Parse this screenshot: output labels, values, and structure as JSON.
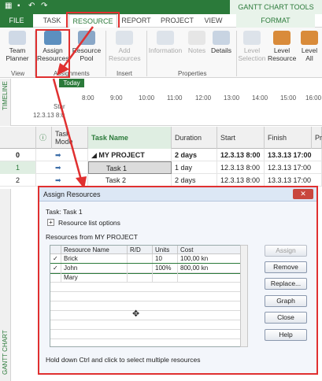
{
  "titlebar": {
    "tools_label": "GANTT CHART TOOLS"
  },
  "tabs": [
    "FILE",
    "TASK",
    "RESOURCE",
    "REPORT",
    "PROJECT",
    "VIEW",
    "FORMAT"
  ],
  "ribbon": {
    "view_group": {
      "button": "Team Planner",
      "label": "View"
    },
    "assignments_group": {
      "assign": "Assign Resources",
      "pool": "Resource Pool",
      "label": "Assignments"
    },
    "insert_group": {
      "add": "Add Resources",
      "label": "Insert"
    },
    "properties_group": {
      "information": "Information",
      "notes": "Notes",
      "details": "Details",
      "label": "Properties"
    },
    "level_group": {
      "selection": "Level Selection",
      "resource": "Level Resource",
      "all": "Level All"
    }
  },
  "timeline": {
    "side_label": "TIMELINE",
    "today": "Today",
    "start_label": "Star",
    "start_date": "12.3.13 8:0",
    "times": [
      "8:00",
      "9:00",
      "10:00",
      "11:00",
      "12:00",
      "13:00",
      "14:00",
      "15:00",
      "16:00"
    ]
  },
  "grid": {
    "headers": {
      "task_mode": "Task Mode",
      "task_name": "Task Name",
      "duration": "Duration",
      "start": "Start",
      "finish": "Finish",
      "pr": "Pr"
    },
    "rows": [
      {
        "id": "0",
        "name": "MY PROJECT",
        "duration": "2 days",
        "start": "12.3.13 8:00",
        "finish": "13.3.13 17:00"
      },
      {
        "id": "1",
        "name": "Task 1",
        "duration": "1 day",
        "start": "12.3.13 8:00",
        "finish": "12.3.13 17:00"
      },
      {
        "id": "2",
        "name": "Task 2",
        "duration": "2 days",
        "start": "12.3.13 8:00",
        "finish": "13.3.13 17:00"
      }
    ],
    "side_label": "GANTT CHART"
  },
  "dialog": {
    "title": "Assign Resources",
    "task": "Task: Task 1",
    "options": "Resource list options",
    "resources_from": "Resources from MY PROJECT",
    "columns": [
      "Resource Name",
      "R/D",
      "Units",
      "Cost"
    ],
    "rows": [
      {
        "check": "✓",
        "name": "Brick",
        "rd": "",
        "units": "10",
        "cost": "100,00 kn"
      },
      {
        "check": "✓",
        "name": "John",
        "rd": "",
        "units": "100%",
        "cost": "800,00 kn"
      },
      {
        "check": "",
        "name": "Mary",
        "rd": "",
        "units": "",
        "cost": ""
      }
    ],
    "buttons": [
      "Assign",
      "Remove",
      "Replace...",
      "Graph",
      "Close",
      "Help"
    ],
    "hint": "Hold down Ctrl and click to select multiple resources"
  }
}
